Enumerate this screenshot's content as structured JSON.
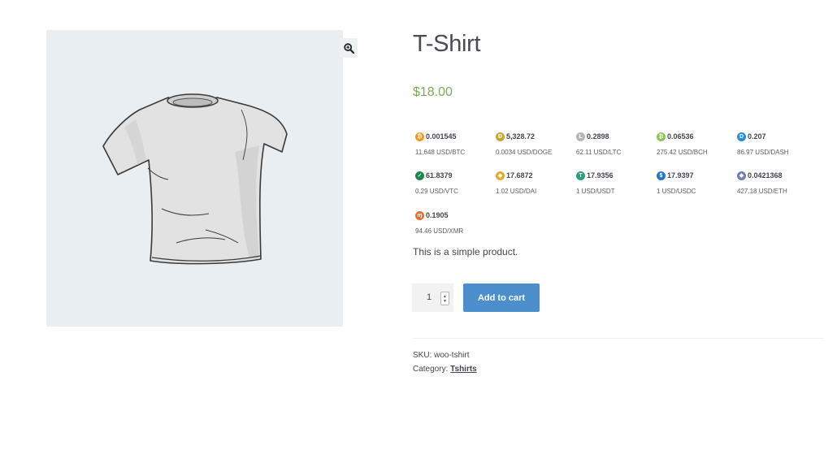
{
  "product": {
    "title": "T-Shirt",
    "price": "$18.00",
    "description": "This is a simple product.",
    "quantity": "1",
    "add_to_cart_label": "Add to cart",
    "sku_label": "SKU:",
    "sku": "woo-tshirt",
    "category_label": "Category:",
    "category": "Tshirts"
  },
  "crypto_prices": [
    {
      "amount": "0.001545",
      "rate": "11,648 USD/BTC",
      "icon": "bitcoin-icon",
      "color": "#f39a1c",
      "glyph": "₿"
    },
    {
      "amount": "5,328.72",
      "rate": "0.0034 USD/DOGE",
      "icon": "dogecoin-icon",
      "color": "#c7a52f",
      "glyph": "Ð"
    },
    {
      "amount": "0.2898",
      "rate": "62.11 USD/LTC",
      "icon": "litecoin-icon",
      "color": "#b5b5b5",
      "glyph": "Ł"
    },
    {
      "amount": "0.06536",
      "rate": "275.42 USD/BCH",
      "icon": "bitcoin-cash-icon",
      "color": "#8cc351",
      "glyph": "₿"
    },
    {
      "amount": "0.207",
      "rate": "86.97 USD/DASH",
      "icon": "dash-icon",
      "color": "#1f8de0",
      "glyph": "D"
    },
    {
      "amount": "61.8379",
      "rate": "0.29 USD/VTC",
      "icon": "vertcoin-icon",
      "color": "#1b8650",
      "glyph": "✓"
    },
    {
      "amount": "17.6872",
      "rate": "1.02 USD/DAI",
      "icon": "dai-icon",
      "color": "#e2a92c",
      "glyph": "◈"
    },
    {
      "amount": "17.9356",
      "rate": "1 USD/USDT",
      "icon": "tether-icon",
      "color": "#26a17b",
      "glyph": "T"
    },
    {
      "amount": "17.9397",
      "rate": "1 USD/USDC",
      "icon": "usd-coin-icon",
      "color": "#2775ca",
      "glyph": "$"
    },
    {
      "amount": "0.0421368",
      "rate": "427.18 USD/ETH",
      "icon": "ethereum-icon",
      "color": "#6f7cba",
      "glyph": "◆"
    },
    {
      "amount": "0.1905",
      "rate": "94.46 USD/XMR",
      "icon": "monero-icon",
      "color": "#f26822",
      "glyph": "ɱ"
    }
  ]
}
